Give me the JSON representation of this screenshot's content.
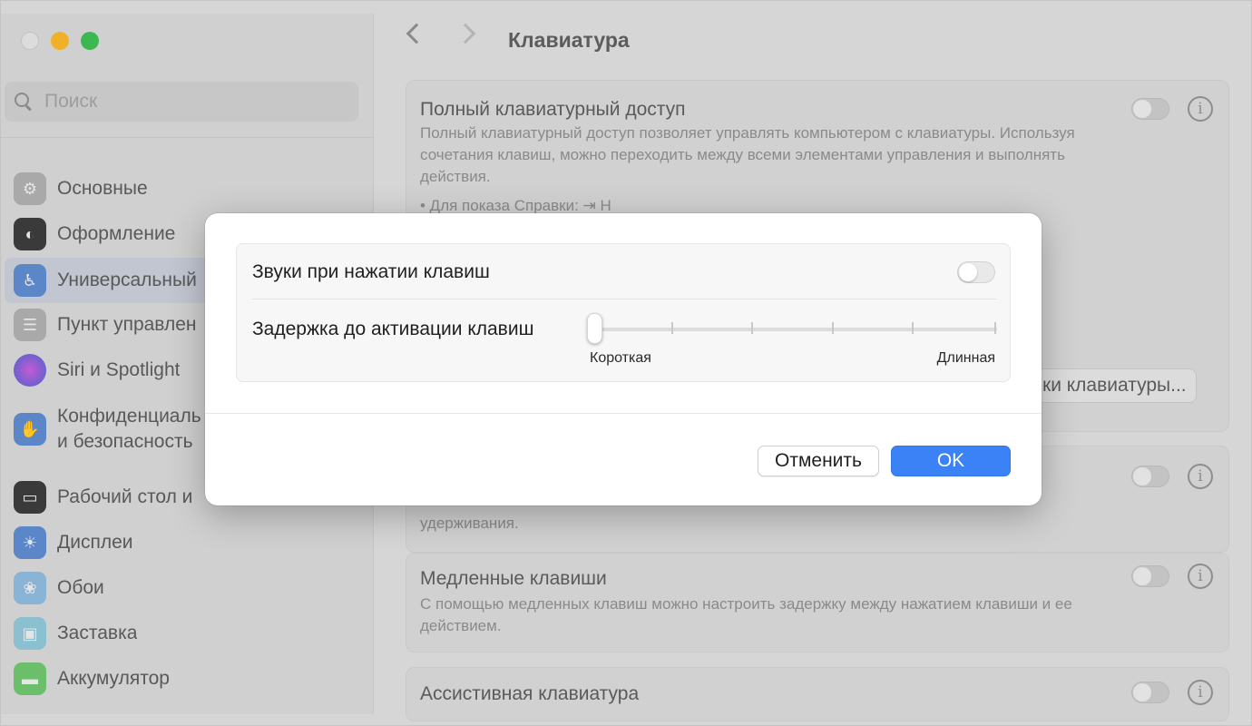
{
  "window": {
    "title": "Клавиатура"
  },
  "sidebar": {
    "search_placeholder": "Поиск",
    "items": [
      {
        "label": "Основные",
        "icon": "gear-icon",
        "color": "#a9a9a9"
      },
      {
        "label": "Оформление",
        "icon": "appearance-icon",
        "color": "#3a3a3a"
      },
      {
        "label": "Универсальный",
        "icon": "accessibility-icon",
        "color": "#5b87c9",
        "active": true
      },
      {
        "label": "Пункт управлен",
        "icon": "control-center-icon",
        "color": "#a9a9a9"
      },
      {
        "label": "Siri и Spotlight",
        "icon": "siri-icon",
        "color": "#7a4fbf"
      },
      {
        "label": "Конфиденциаль и безопасность",
        "icon": "privacy-hand-icon",
        "color": "#5b87c9"
      },
      {
        "label": "Рабочий стол и",
        "icon": "desktop-icon",
        "color": "#3a3a3a"
      },
      {
        "label": "Дисплеи",
        "icon": "display-icon",
        "color": "#5b87c9"
      },
      {
        "label": "Обои",
        "icon": "wallpaper-icon",
        "color": "#8ab4d6"
      },
      {
        "label": "Заставка",
        "icon": "screensaver-icon",
        "color": "#8ac0cf"
      },
      {
        "label": "Аккумулятор",
        "icon": "battery-icon",
        "color": "#6bbf6b"
      }
    ]
  },
  "main": {
    "sections": [
      {
        "title": "Полный клавиатурный доступ",
        "desc": "Полный клавиатурный доступ позволяет управлять компьютером с клавиатуры. Используя сочетания клавиш, можно переходить между всеми элементами управления и выполнять действия.",
        "hint": "• Для показа Справки: ⇥ H"
      },
      {
        "title": "",
        "desc_tail": "удерживания."
      },
      {
        "title": "Медленные клавиши",
        "desc": "С помощью медленных клавиш можно настроить задержку между нажатием клавиши и ее действием."
      },
      {
        "title": "Ассистивная клавиатура"
      }
    ],
    "keyboard_settings_button": "ки клавиатуры..."
  },
  "modal": {
    "row1_label": "Звуки при нажатии клавиш",
    "row1_toggle": false,
    "row2_label": "Задержка до активации клавиш",
    "slider_min_label": "Короткая",
    "slider_max_label": "Длинная",
    "slider_value": 0,
    "cancel_label": "Отменить",
    "ok_label": "OK",
    "accent_color": "#3b82f6"
  }
}
